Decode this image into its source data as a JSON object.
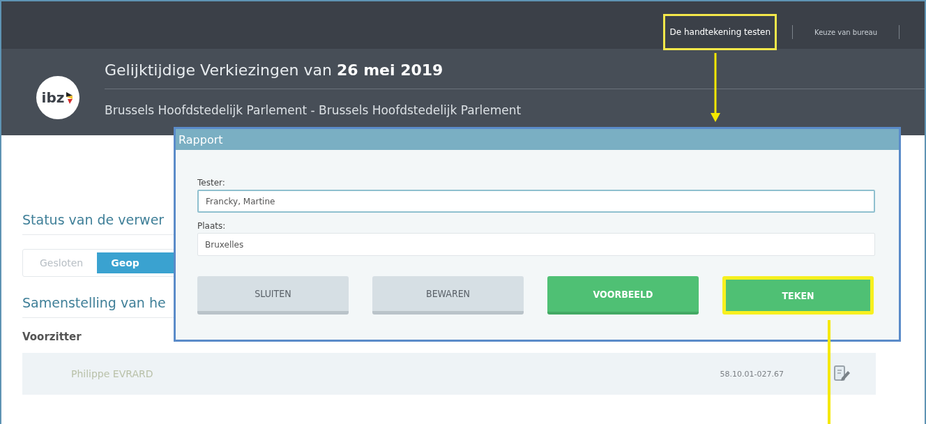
{
  "top_nav": [
    {
      "label": "De handtekening testen",
      "highlighted": true
    },
    {
      "label": "Keuze van bureau",
      "highlighted": false
    }
  ],
  "header": {
    "logo_text": "ibz",
    "title": "Gelijktijdige Verkiezingen van **26 mei 2019**",
    "subtitle": "Brussels Hoofdstedelijk Parlement - Brussels Hoofdstedelijk Parlement"
  },
  "body": {
    "status_heading": "Status van de verwer",
    "status_toggle": [
      {
        "label": "Gesloten",
        "selected": false
      },
      {
        "label": "Geop",
        "selected": true
      }
    ],
    "composition_heading": "Samenstelling van he",
    "section_label": "Voorzitter",
    "member_row": {
      "name": "Philippe EVRARD",
      "national_number": "58.10.01-027.67"
    }
  },
  "dialog": {
    "title": "Rapport",
    "fields": [
      {
        "label": "Tester:",
        "value": "Francky, Martine",
        "focused": true
      },
      {
        "label": "Plaats:",
        "value": "Bruxelles",
        "focused": false
      }
    ],
    "buttons": [
      {
        "label": "SLUITEN",
        "kind": "secondary",
        "highlighted": false
      },
      {
        "label": "BEWAREN",
        "kind": "secondary",
        "highlighted": false
      },
      {
        "label": "VOORBEELD",
        "kind": "primary",
        "highlighted": false
      },
      {
        "label": "TEKEN",
        "kind": "primary",
        "highlighted": true
      }
    ]
  }
}
